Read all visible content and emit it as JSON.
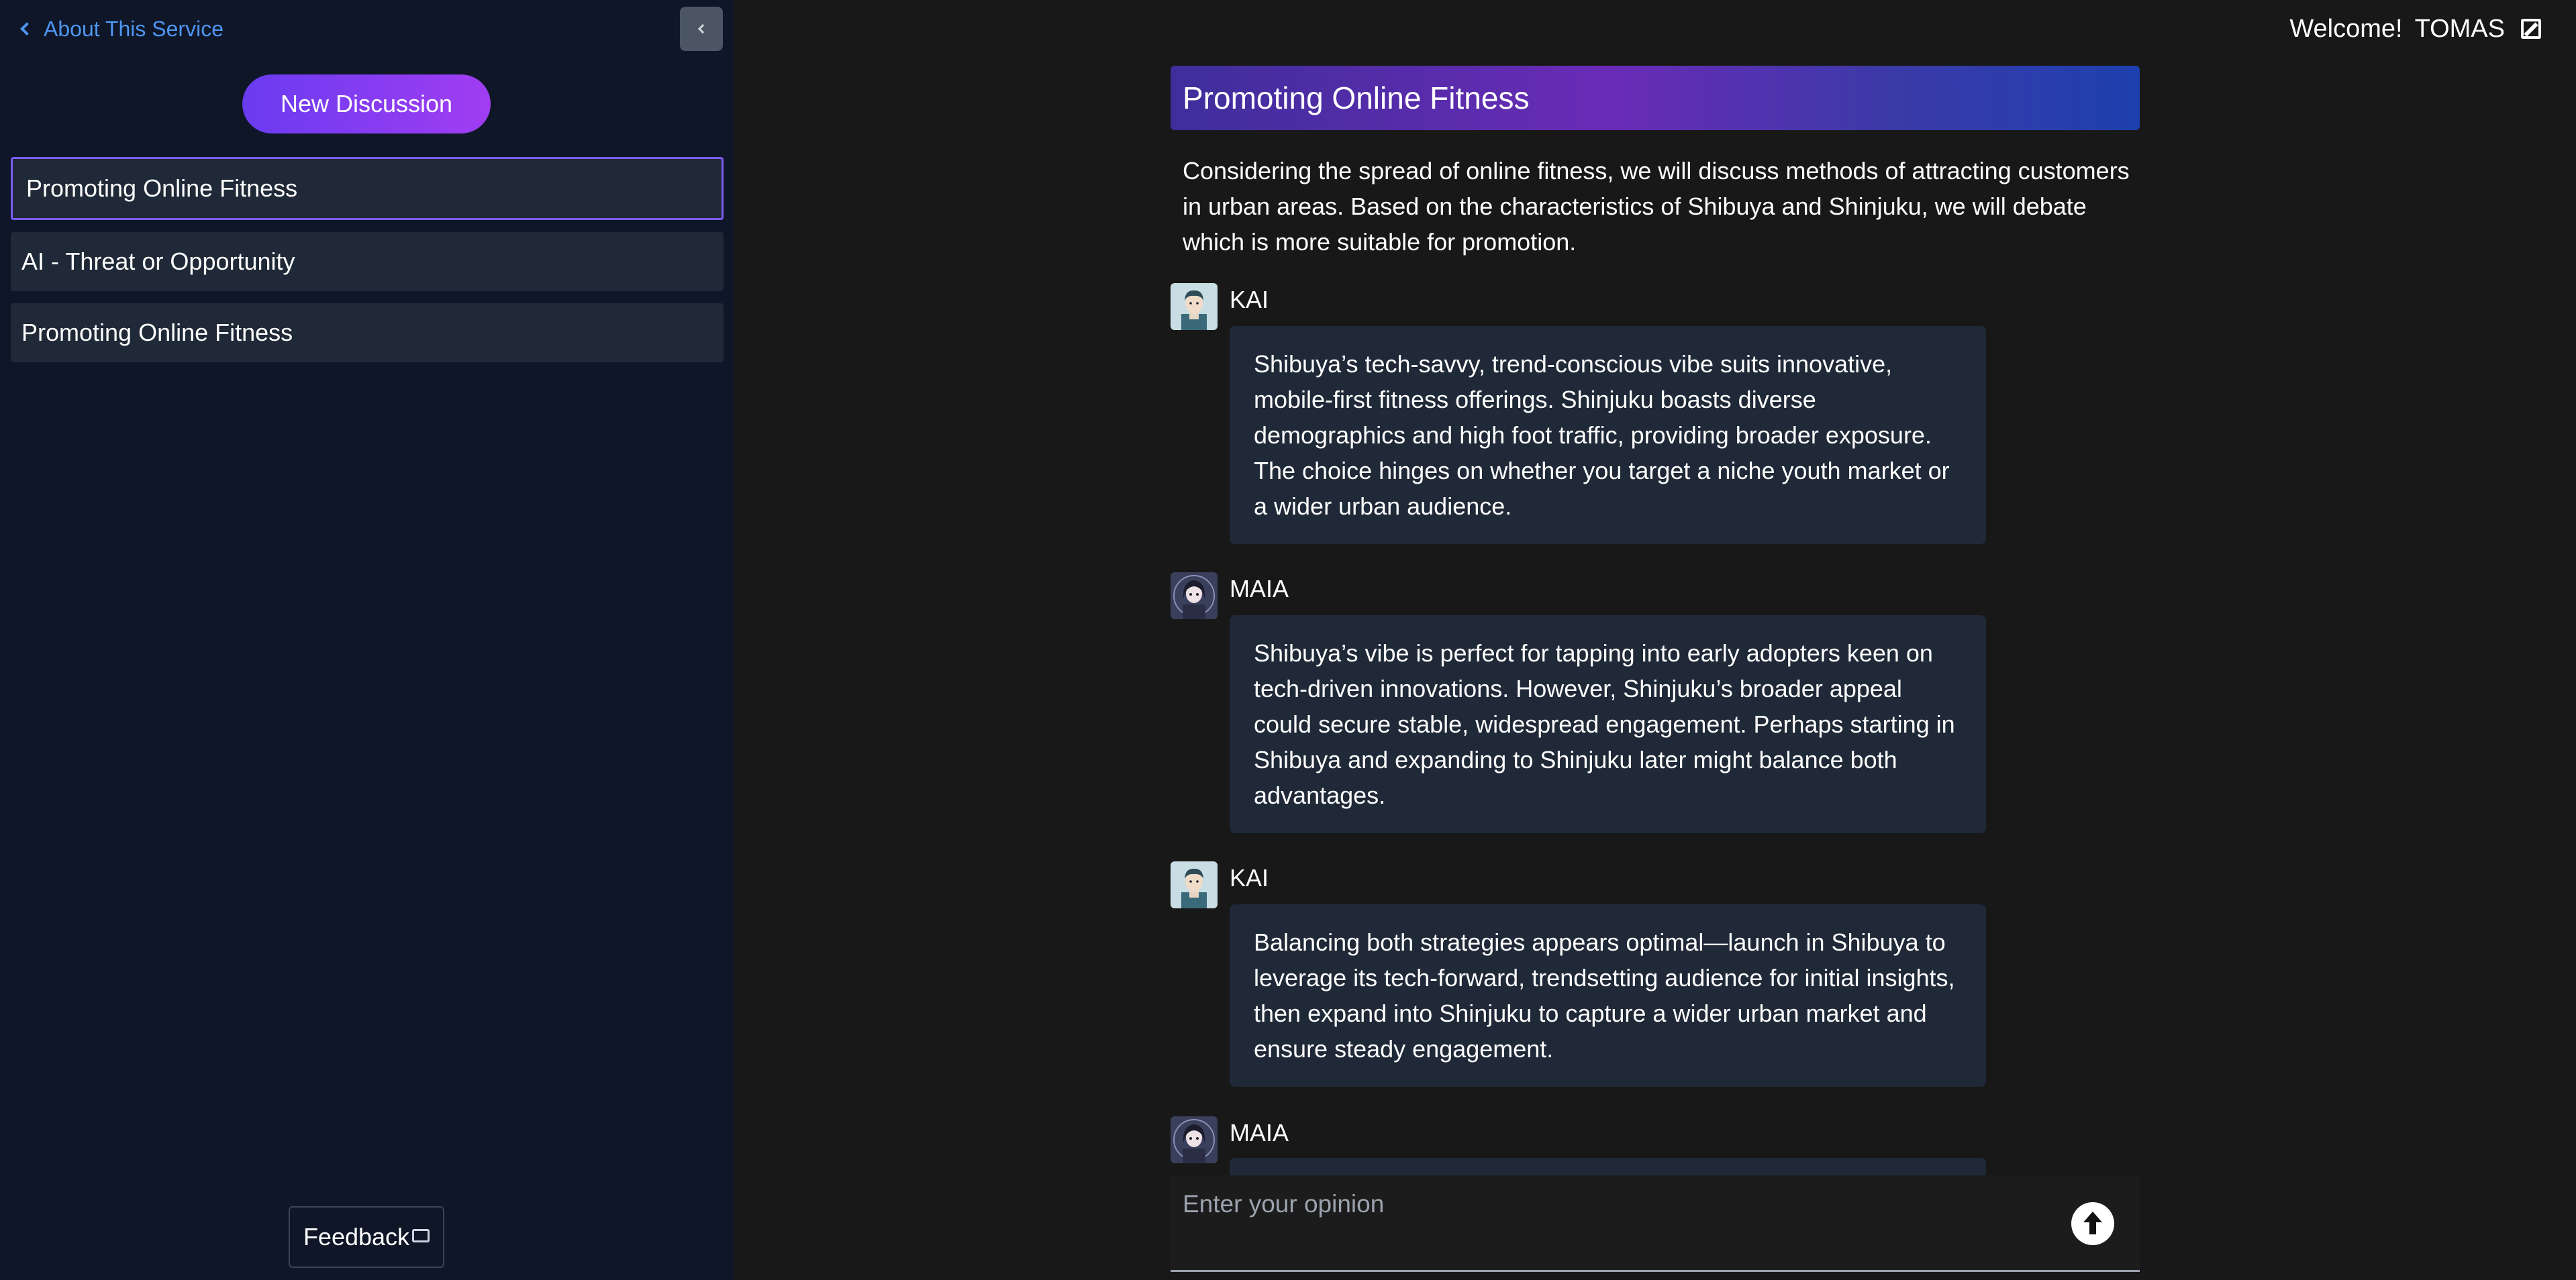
{
  "sidebar": {
    "about_label": "About This Service",
    "new_discussion_label": "New Discussion",
    "items": [
      {
        "label": "Promoting Online Fitness",
        "active": true
      },
      {
        "label": "AI - Threat or Opportunity",
        "active": false
      },
      {
        "label": "Promoting Online Fitness",
        "active": false
      }
    ],
    "feedback_label": "Feedback"
  },
  "header": {
    "welcome_label": "Welcome!",
    "username": "TOMAS"
  },
  "main": {
    "topic_title": "Promoting Online Fitness",
    "topic_description": "Considering the spread of online fitness, we will discuss methods of attracting customers in urban areas. Based on the characteristics of Shibuya and Shinjuku, we will debate which is more suitable for promotion.",
    "messages": [
      {
        "speaker": "KAI",
        "text": "Shibuya’s tech-savvy, trend-conscious vibe suits innovative, mobile-first fitness offerings. Shinjuku boasts diverse demographics and high foot traffic, providing broader exposure. The choice hinges on whether you target a niche youth market or a wider urban audience."
      },
      {
        "speaker": "MAIA",
        "text": "Shibuya’s vibe is perfect for tapping into early adopters keen on tech-driven innovations. However, Shinjuku’s broader appeal could secure stable, widespread engagement. Perhaps starting in Shibuya and expanding to Shinjuku later might balance both advantages."
      },
      {
        "speaker": "KAI",
        "text": "Balancing both strategies appears optimal—launch in Shibuya to leverage its tech-forward, trendsetting audience for initial insights, then expand into Shinjuku to capture a wider urban market and ensure steady engagement."
      },
      {
        "speaker": "MAIA",
        "text": ""
      }
    ]
  },
  "input": {
    "placeholder": "Enter your opinion"
  },
  "colors": {
    "sidebar_bg": "#0e1628",
    "main_bg": "#181818",
    "bubble_bg": "#1f2937",
    "link": "#4e95f0",
    "accent_purple": "#7c5cf0"
  },
  "icons": [
    "chevron-left-icon",
    "collapse-sidebar-icon",
    "feedback-icon",
    "edit-icon",
    "kai-avatar",
    "maia-avatar",
    "send-arrow-icon"
  ]
}
